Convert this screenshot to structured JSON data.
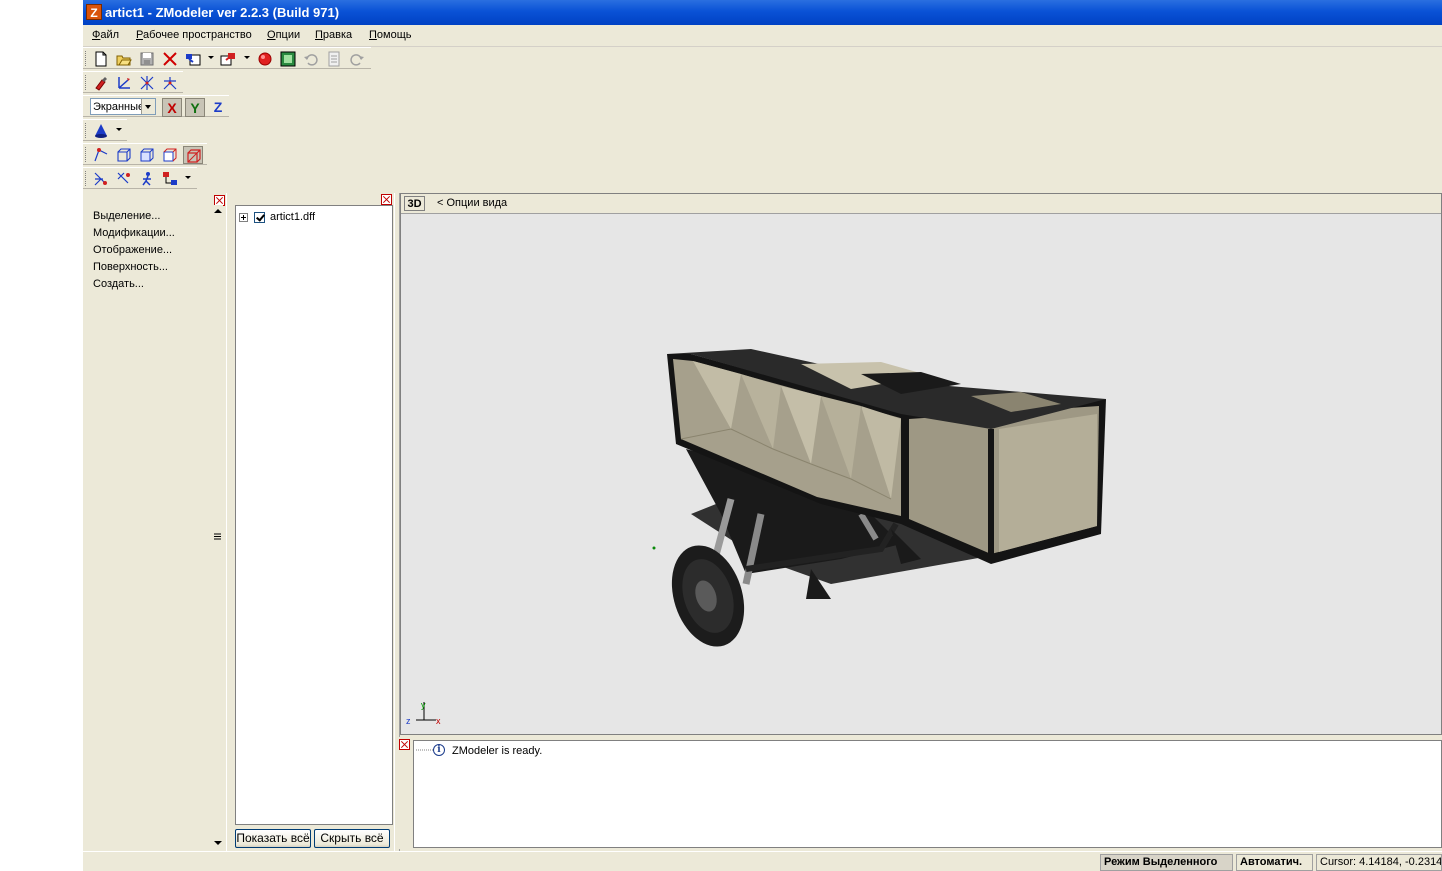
{
  "window": {
    "title": "artict1 - ZModeler ver 2.2.3 (Build 971)",
    "app_icon": "Z"
  },
  "menu": [
    "Файл",
    "Рабочее пространство",
    "Опции",
    "Правка",
    "Помощь"
  ],
  "toolbar": {
    "coord_combo": "Экранные",
    "axis_x": "X",
    "axis_y": "Y",
    "axis_z": "Z",
    "icons": [
      "new-file-icon",
      "open-folder-icon",
      "save-icon",
      "close-x-icon",
      "import-icon",
      "export-icon",
      "record-icon",
      "render-icon",
      "undo-icon",
      "document-icon",
      "redo-icon"
    ]
  },
  "command_panel": {
    "items": [
      "Выделение...",
      "Модификации...",
      "Отображение...",
      "Поверхность...",
      "Создать..."
    ]
  },
  "tree_panel": {
    "item": "artict1.dff",
    "show_all": "Показать всё",
    "hide_all": "Скрыть всё"
  },
  "viewport": {
    "mode": "3D",
    "options": "<  Опции вида",
    "gizmo_y": "y",
    "gizmo_z": "z",
    "gizmo_x": "x"
  },
  "log": {
    "message": "ZModeler is ready."
  },
  "status": {
    "mode": "Режим Выделенного",
    "auto": "Автоматич.",
    "cursor": "Cursor: 4.14184, -0.23140"
  },
  "colors": {
    "title_bg": "#0a52d6",
    "panel_bg": "#ece9d8",
    "viewport_bg": "#e6e6e6",
    "close_red": "#c00000"
  }
}
